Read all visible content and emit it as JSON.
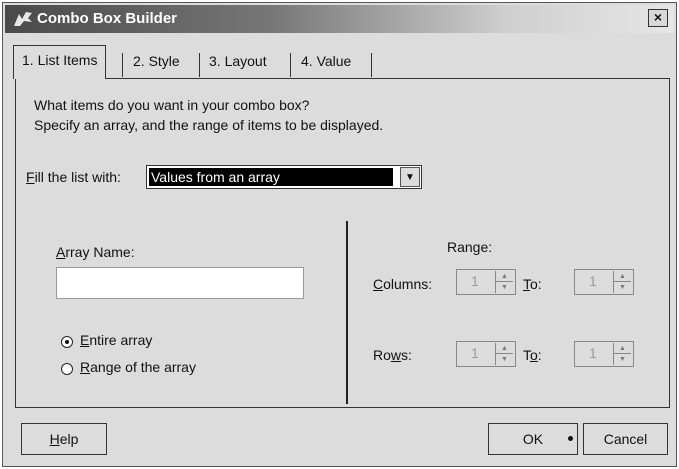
{
  "window": {
    "title": "Combo Box Builder",
    "close_label": "×"
  },
  "tabs": [
    {
      "label": "1. List Items",
      "active": true
    },
    {
      "label": "2. Style",
      "active": false
    },
    {
      "label": "3. Layout",
      "active": false
    },
    {
      "label": "4. Value",
      "active": false
    }
  ],
  "list_items": {
    "instruction_line1": "What items do you want in your combo box?",
    "instruction_line2": "Specify an array, and the range of items to be displayed.",
    "fill_label": "Fill the list with:",
    "fill_value": "Values from an array",
    "array_name_label": "Array Name:",
    "array_name_value": "",
    "radio_entire": "Entire array",
    "radio_range": "Range of the array",
    "selected_radio": "Entire array",
    "range_heading": "Range:",
    "columns_label": "Columns:",
    "rows_label": "Rows:",
    "to_label": "To:",
    "columns_from": "1",
    "columns_to": "1",
    "rows_from": "1",
    "rows_to": "1"
  },
  "footer": {
    "help_label": "Help",
    "ok_label": "OK",
    "cancel_label": "Cancel"
  }
}
